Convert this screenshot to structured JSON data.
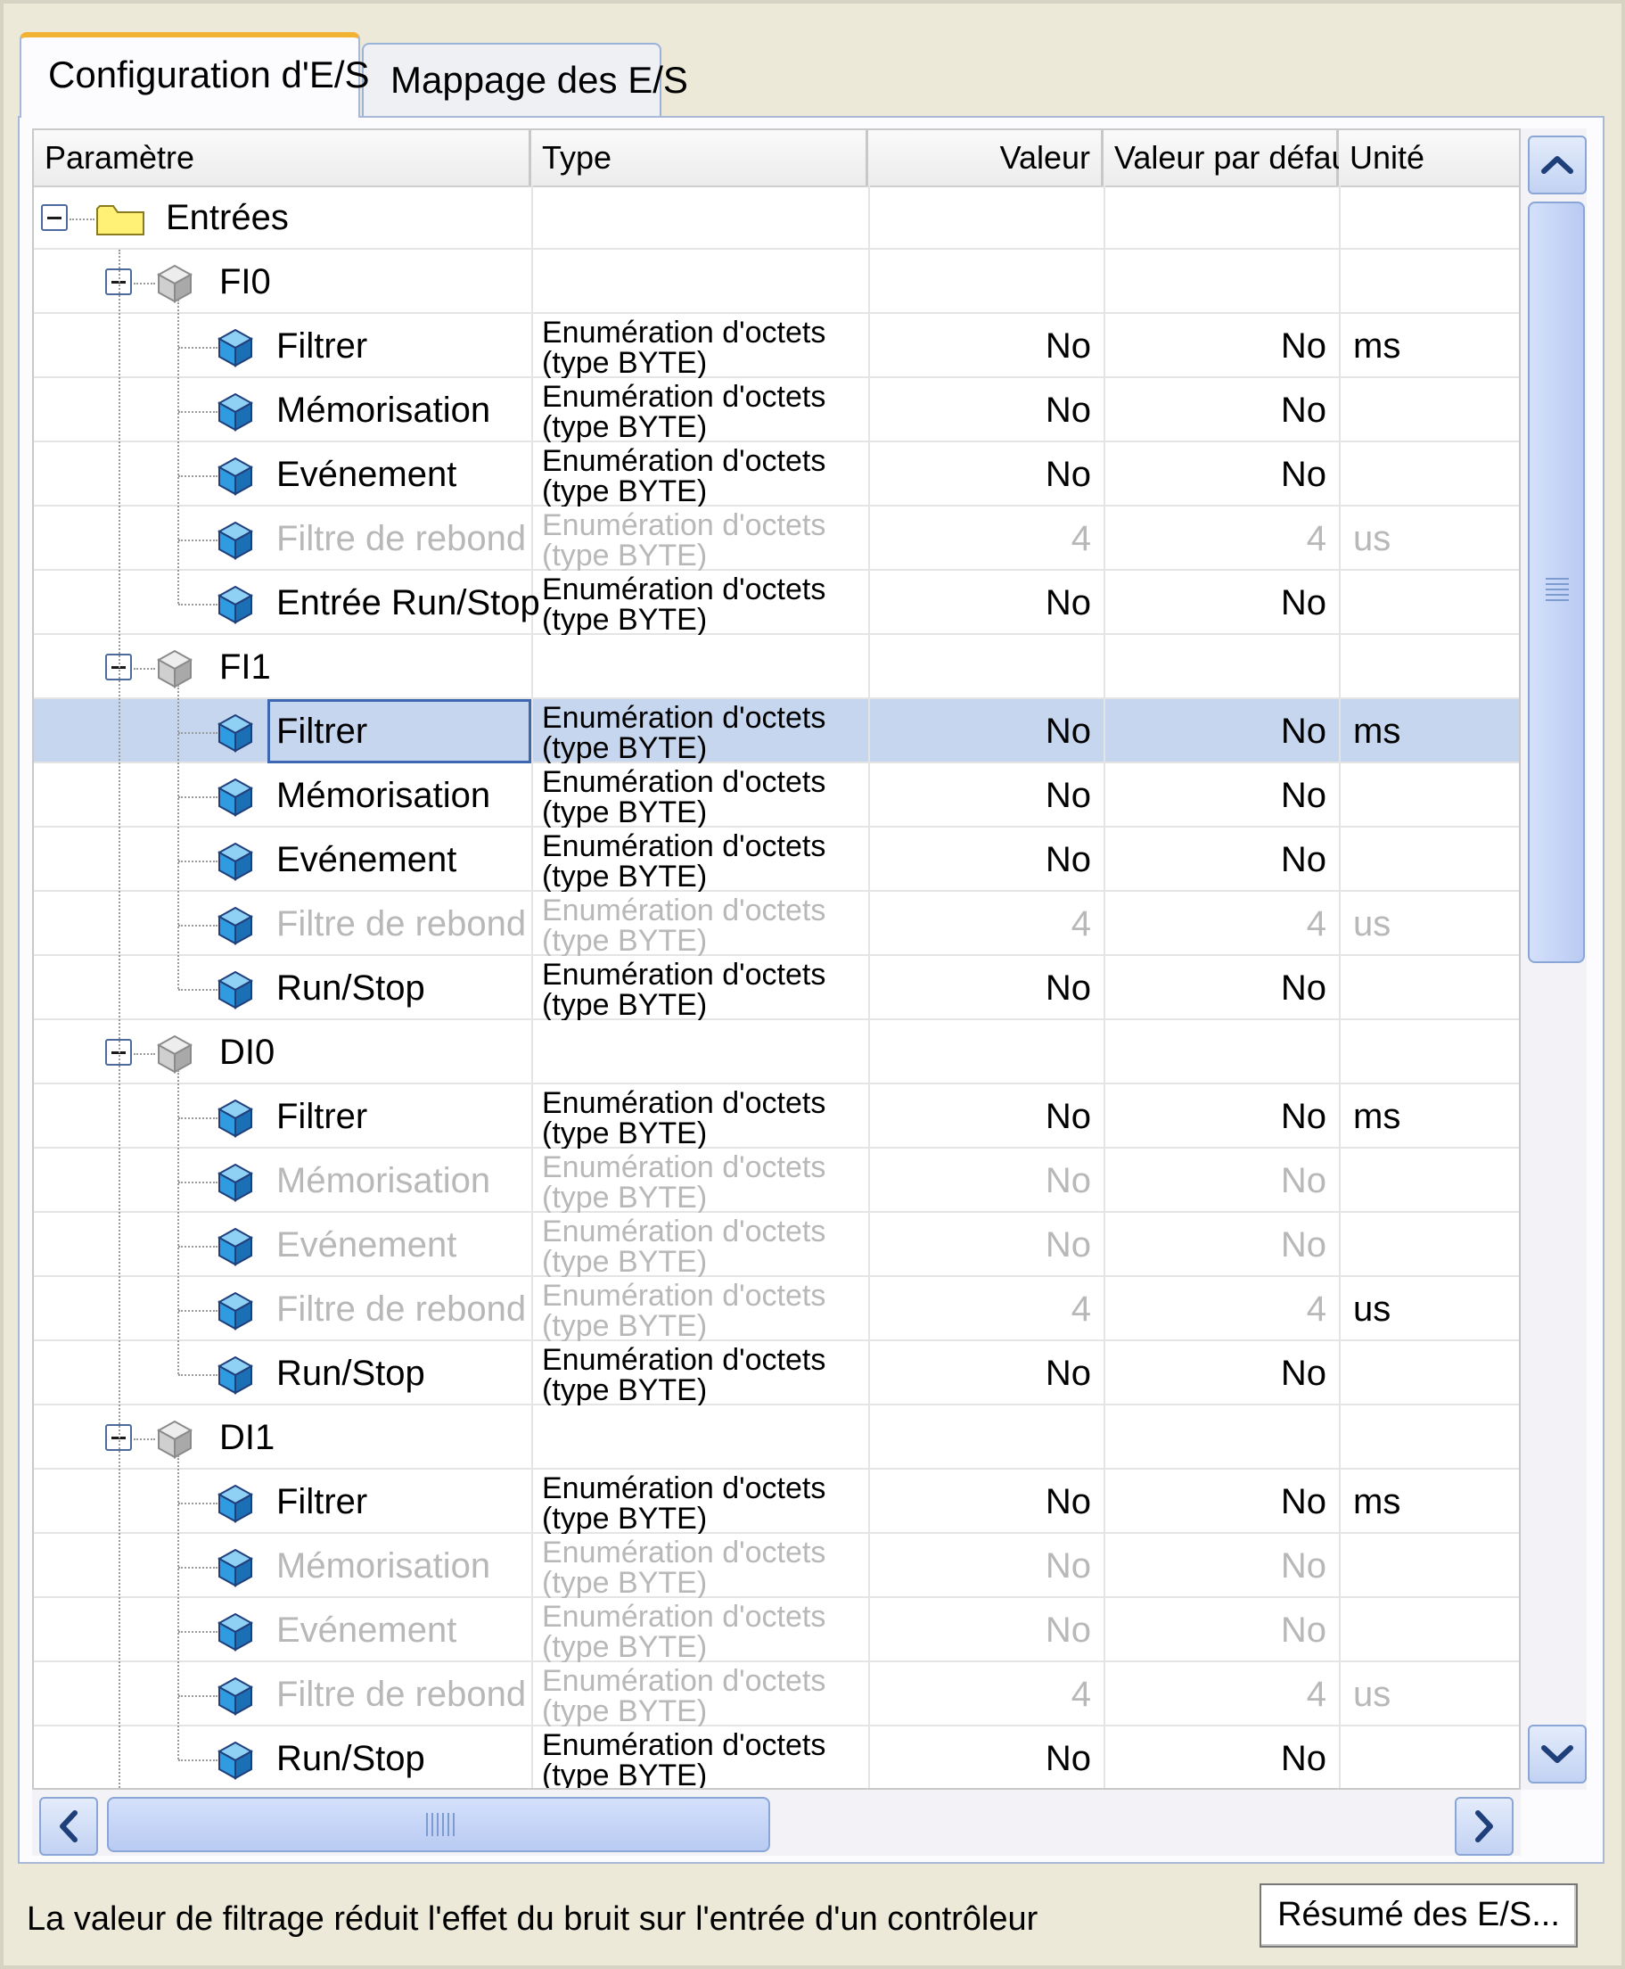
{
  "tabs": [
    {
      "label": "Configuration d'E/S",
      "active": true
    },
    {
      "label": "Mappage des E/S",
      "active": false
    }
  ],
  "columns": {
    "parametre": "Paramètre",
    "type": "Type",
    "valeur": "Valeur",
    "defaut": "Valeur par défaut",
    "unite": "Unité"
  },
  "rows": [
    {
      "kind": "root",
      "name": "Entrées"
    },
    {
      "kind": "group",
      "name": "FI0"
    },
    {
      "kind": "param",
      "name": "Filtrer",
      "type1": "Enumération d'octets",
      "type2": "(type BYTE)",
      "value": "No",
      "default": "No",
      "unit": "ms",
      "disabled": false
    },
    {
      "kind": "param",
      "name": "Mémorisation",
      "type1": "Enumération d'octets",
      "type2": "(type BYTE)",
      "value": "No",
      "default": "No",
      "unit": "",
      "disabled": false
    },
    {
      "kind": "param",
      "name": "Evénement",
      "type1": "Enumération d'octets",
      "type2": "(type BYTE)",
      "value": "No",
      "default": "No",
      "unit": "",
      "disabled": false
    },
    {
      "kind": "param",
      "name": "Filtre de rebond",
      "type1": "Enumération d'octets",
      "type2": "(type BYTE)",
      "value": "4",
      "default": "4",
      "unit": "us",
      "disabled": true
    },
    {
      "kind": "param",
      "name": "Entrée Run/Stop",
      "type1": "Enumération d'octets",
      "type2": "(type BYTE)",
      "value": "No",
      "default": "No",
      "unit": "",
      "disabled": false,
      "last": true
    },
    {
      "kind": "group",
      "name": "FI1"
    },
    {
      "kind": "param",
      "name": "Filtrer",
      "type1": "Enumération d'octets",
      "type2": "(type BYTE)",
      "value": "No",
      "default": "No",
      "unit": "ms",
      "disabled": false,
      "selected": true
    },
    {
      "kind": "param",
      "name": "Mémorisation",
      "type1": "Enumération d'octets",
      "type2": "(type BYTE)",
      "value": "No",
      "default": "No",
      "unit": "",
      "disabled": false
    },
    {
      "kind": "param",
      "name": "Evénement",
      "type1": "Enumération d'octets",
      "type2": "(type BYTE)",
      "value": "No",
      "default": "No",
      "unit": "",
      "disabled": false
    },
    {
      "kind": "param",
      "name": "Filtre de rebond",
      "type1": "Enumération d'octets",
      "type2": "(type BYTE)",
      "value": "4",
      "default": "4",
      "unit": "us",
      "disabled": true
    },
    {
      "kind": "param",
      "name": "Run/Stop",
      "type1": "Enumération d'octets",
      "type2": "(type BYTE)",
      "value": "No",
      "default": "No",
      "unit": "",
      "disabled": false,
      "last": true
    },
    {
      "kind": "group",
      "name": "DI0"
    },
    {
      "kind": "param",
      "name": "Filtrer",
      "type1": "Enumération d'octets",
      "type2": "(type BYTE)",
      "value": "No",
      "default": "No",
      "unit": "ms",
      "disabled": false
    },
    {
      "kind": "param",
      "name": "Mémorisation",
      "type1": "Enumération d'octets",
      "type2": "(type BYTE)",
      "value": "No",
      "default": "No",
      "unit": "",
      "disabled": true
    },
    {
      "kind": "param",
      "name": "Evénement",
      "type1": "Enumération d'octets",
      "type2": "(type BYTE)",
      "value": "No",
      "default": "No",
      "unit": "",
      "disabled": true
    },
    {
      "kind": "param",
      "name": "Filtre de rebond",
      "type1": "Enumération d'octets",
      "type2": "(type BYTE)",
      "value": "4",
      "default": "4",
      "unit": "us",
      "disabled": true,
      "unitEnabled": true
    },
    {
      "kind": "param",
      "name": "Run/Stop",
      "type1": "Enumération d'octets",
      "type2": "(type BYTE)",
      "value": "No",
      "default": "No",
      "unit": "",
      "disabled": false,
      "last": true
    },
    {
      "kind": "group",
      "name": "DI1"
    },
    {
      "kind": "param",
      "name": "Filtrer",
      "type1": "Enumération d'octets",
      "type2": "(type BYTE)",
      "value": "No",
      "default": "No",
      "unit": "ms",
      "disabled": false
    },
    {
      "kind": "param",
      "name": "Mémorisation",
      "type1": "Enumération d'octets",
      "type2": "(type BYTE)",
      "value": "No",
      "default": "No",
      "unit": "",
      "disabled": true
    },
    {
      "kind": "param",
      "name": "Evénement",
      "type1": "Enumération d'octets",
      "type2": "(type BYTE)",
      "value": "No",
      "default": "No",
      "unit": "",
      "disabled": true
    },
    {
      "kind": "param",
      "name": "Filtre de rebond",
      "type1": "Enumération d'octets",
      "type2": "(type BYTE)",
      "value": "4",
      "default": "4",
      "unit": "us",
      "disabled": true
    },
    {
      "kind": "param",
      "name": "Run/Stop",
      "type1": "Enumération d'octets",
      "type2": "(type BYTE)",
      "value": "No",
      "default": "No",
      "unit": "",
      "disabled": false,
      "last": true
    }
  ],
  "status_text": "La valeur de filtrage réduit l'effet du bruit sur l'entrée d'un contrôleur",
  "summary_button": "Résumé des E/S...",
  "colors": {
    "selection": "#c6d6ee",
    "disabled_text": "#b8b8b8",
    "tab_accent": "#f2b233",
    "folder": "#fff176",
    "cube_blue": "#2f9be0"
  }
}
